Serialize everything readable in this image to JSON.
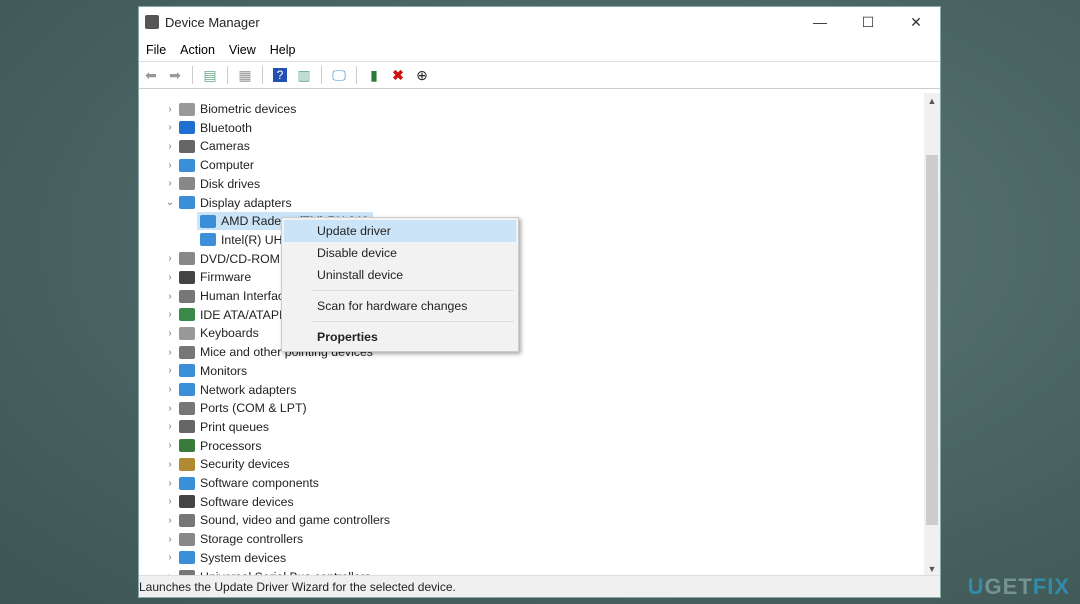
{
  "window": {
    "title": "Device Manager",
    "minimize": "—",
    "maximize": "☐",
    "close": "✕"
  },
  "menu": [
    "File",
    "Action",
    "View",
    "Help"
  ],
  "toolbar": [
    "back-icon",
    "forward-icon",
    "show-hide-console-tree-icon",
    "properties-icon",
    "help-icon",
    "action-pane-icon",
    "scan-hardware-icon",
    "update-driver-icon",
    "uninstall-icon",
    "disable-icon"
  ],
  "tree": [
    {
      "label": "Biometric devices",
      "color": "#999"
    },
    {
      "label": "Bluetooth",
      "color": "#1e6fd0"
    },
    {
      "label": "Cameras",
      "color": "#666"
    },
    {
      "label": "Computer",
      "color": "#3a8fd8"
    },
    {
      "label": "Disk drives",
      "color": "#888"
    },
    {
      "label": "Display adapters",
      "color": "#3a8fd8",
      "expanded": true
    },
    {
      "label": "AMD Radeon (TM) RX 640",
      "color": "#3a8fd8",
      "child": true,
      "selected": true
    },
    {
      "label": "Intel(R) UHD Graphics 620",
      "color": "#3a8fd8",
      "child": true
    },
    {
      "label": "DVD/CD-ROM drives",
      "color": "#888"
    },
    {
      "label": "Firmware",
      "color": "#444"
    },
    {
      "label": "Human Interface Devices",
      "color": "#777"
    },
    {
      "label": "IDE ATA/ATAPI controllers",
      "color": "#3a8a4a"
    },
    {
      "label": "Keyboards",
      "color": "#999"
    },
    {
      "label": "Mice and other pointing devices",
      "color": "#777"
    },
    {
      "label": "Monitors",
      "color": "#3a8fd8"
    },
    {
      "label": "Network adapters",
      "color": "#3a8fd8"
    },
    {
      "label": "Ports (COM & LPT)",
      "color": "#777"
    },
    {
      "label": "Print queues",
      "color": "#666"
    },
    {
      "label": "Processors",
      "color": "#3a7a3a"
    },
    {
      "label": "Security devices",
      "color": "#b08a30"
    },
    {
      "label": "Software components",
      "color": "#3a8fd8"
    },
    {
      "label": "Software devices",
      "color": "#444"
    },
    {
      "label": "Sound, video and game controllers",
      "color": "#777"
    },
    {
      "label": "Storage controllers",
      "color": "#888"
    },
    {
      "label": "System devices",
      "color": "#3a8fd8"
    },
    {
      "label": "Universal Serial Bus controllers",
      "color": "#777"
    }
  ],
  "context_menu": {
    "update": "Update driver",
    "disable": "Disable device",
    "uninstall": "Uninstall device",
    "scan": "Scan for hardware changes",
    "properties": "Properties"
  },
  "status": "Launches the Update Driver Wizard for the selected device.",
  "watermark": "UGETFIX"
}
